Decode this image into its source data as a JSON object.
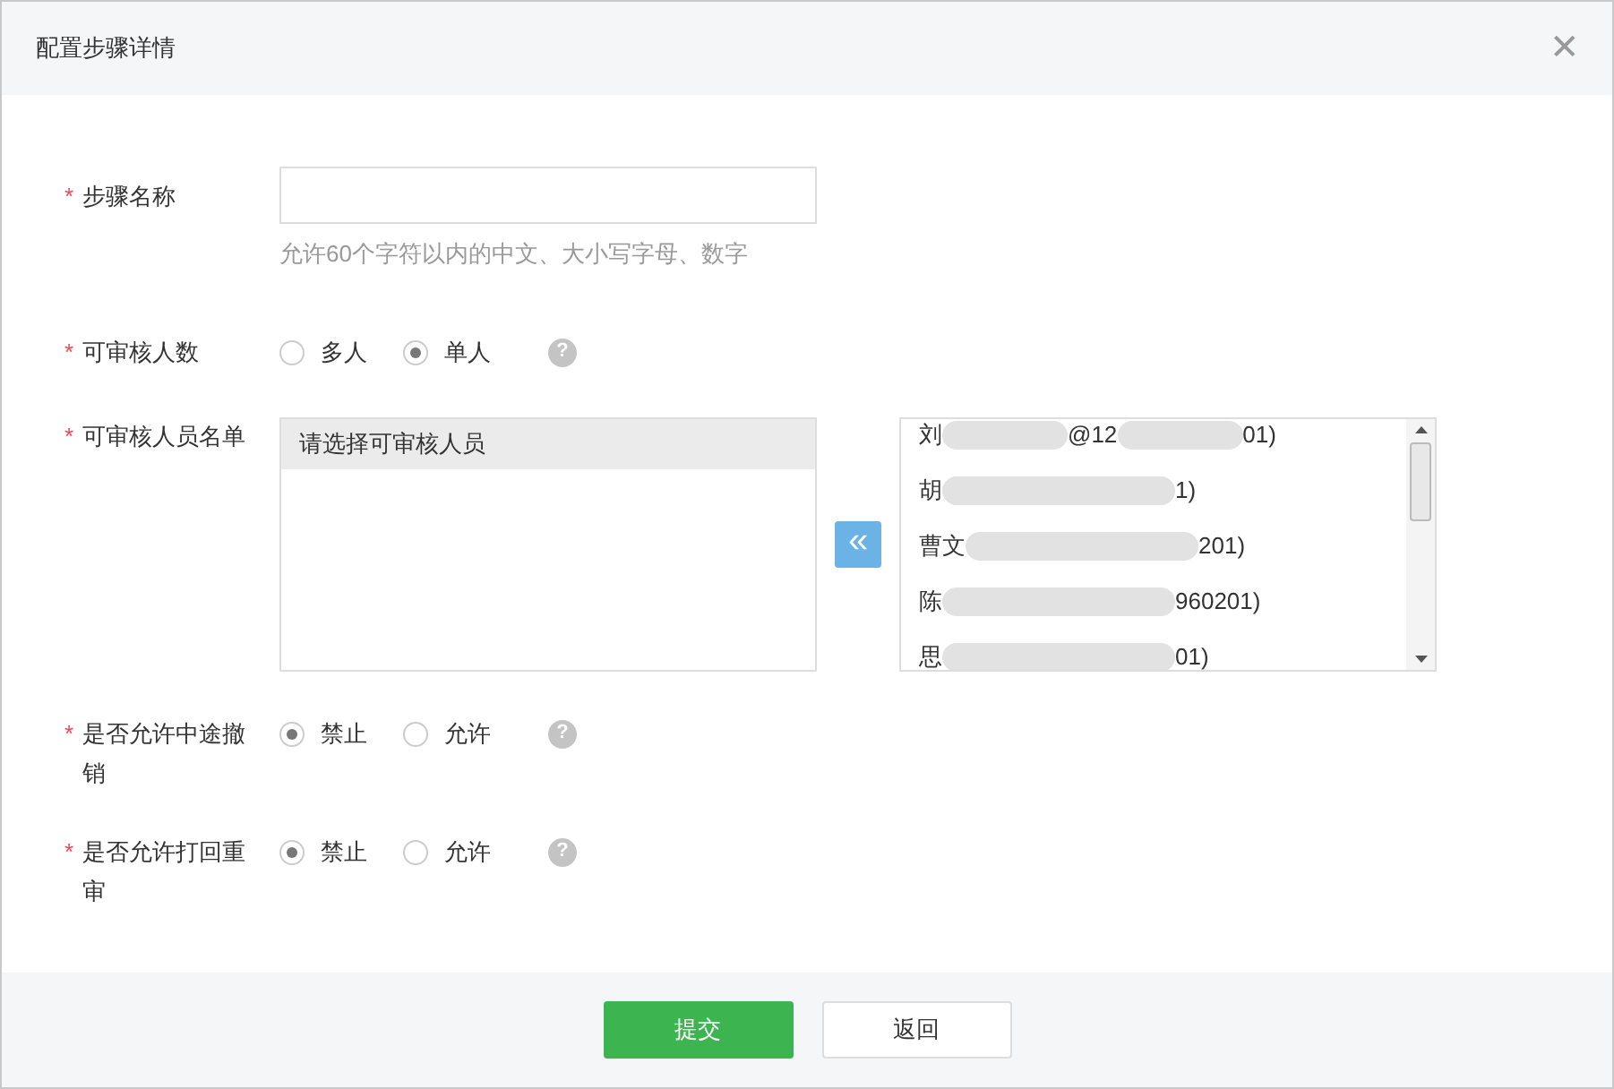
{
  "dialog": {
    "title": "配置步骤详情",
    "close": "✕"
  },
  "fields": [
    {
      "kind": "text",
      "required": "*",
      "label": "步骤名称",
      "hint": "允许60个字符以内的中文、大小写字母、数字"
    },
    {
      "kind": "radio",
      "required": "*",
      "label": "可审核人数",
      "help": "?",
      "options": [
        {
          "label": "多人",
          "selected": false
        },
        {
          "label": "单人",
          "selected": true
        }
      ]
    },
    {
      "kind": "transfer",
      "required": "*",
      "label": "可审核人员名单",
      "selected_list": [
        {
          "label": "请选择可审核人员",
          "highlighted": true
        }
      ],
      "move_button": "«",
      "available": [
        {
          "segments": [
            "刘",
            "@12",
            "01)"
          ]
        },
        {
          "segments": [
            "胡",
            "1)"
          ]
        },
        {
          "segments": [
            "曹文",
            "201)"
          ]
        },
        {
          "segments": [
            "陈",
            "960201)"
          ]
        },
        {
          "segments": [
            "思",
            "01)"
          ]
        }
      ]
    },
    {
      "kind": "radio",
      "required": "*",
      "label": "是否允许中途撤销",
      "help": "?",
      "options": [
        {
          "label": "禁止",
          "selected": true
        },
        {
          "label": "允许",
          "selected": false
        }
      ]
    },
    {
      "kind": "radio",
      "required": "*",
      "label": "是否允许打回重审",
      "help": "?",
      "options": [
        {
          "label": "禁止",
          "selected": true
        },
        {
          "label": "允许",
          "selected": false
        }
      ]
    }
  ],
  "footer": {
    "buttons": [
      {
        "label": "提交",
        "kind": "primary"
      },
      {
        "label": "返回",
        "kind": "secondary"
      }
    ]
  }
}
